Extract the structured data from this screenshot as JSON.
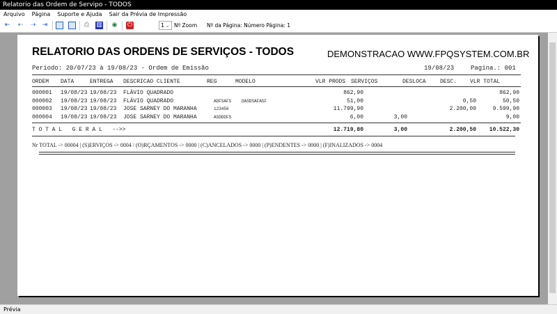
{
  "window": {
    "title": "Relatorio das Ordem de Servipo - TODOS"
  },
  "menu": [
    "Arquivo",
    "Página",
    "Suporte e Ajuda",
    "Sair da Prévia de Impressão"
  ],
  "toolbar": {
    "zoom_value": "1",
    "zoom_label": "Nº Zoom",
    "page_label": "Nº da Página: Número Página: 1"
  },
  "report": {
    "title": "RELATORIO DAS ORDENS DE SERVIÇOS - TODOS",
    "demo": "DEMONSTRACAO WWW.FPQSYSTEM.COM.BR",
    "period": "Periodo: 20/07/23 à 19/08/23 - Ordem de Emissão",
    "date": "19/08/23",
    "page": "Pagina.: 001",
    "headers": [
      "ORDEM",
      "DATA",
      "ENTREGA",
      "DESCRICAO CLIENTE",
      "REG",
      "MODELO",
      "VLR PRODS",
      "SERVIÇOS",
      "DESLOCA",
      "DESC.",
      "VLR TOTAL"
    ],
    "rows": [
      {
        "ordem": "000001",
        "data": "19/08/23",
        "entrega": "19/08/23",
        "cliente": "FLÁVIO QUADRADO",
        "reg": "",
        "modelo": "",
        "prods": "862,90",
        "serv": "",
        "desloca": "",
        "desc": "",
        "total": "862,90"
      },
      {
        "ordem": "000002",
        "data": "19/08/23",
        "entrega": "19/08/23",
        "cliente": "FLÁVIO QUADRADO",
        "reg": "ADFSAFS",
        "modelo": "DASDSAFASF",
        "prods": "51,00",
        "serv": "",
        "desloca": "",
        "desc": "0,50",
        "total": "50,50"
      },
      {
        "ordem": "000003",
        "data": "19/08/23",
        "entrega": "19/08/23",
        "cliente": "JOSE SARNEY DO MARANHA",
        "reg": "123456",
        "modelo": "",
        "prods": "11.799,90",
        "serv": "",
        "desloca": "",
        "desc": "2.200,00",
        "total": "9.599,90"
      },
      {
        "ordem": "000004",
        "data": "19/08/23",
        "entrega": "19/08/23",
        "cliente": "JOSE SARNEY DO MARANHA",
        "reg": "ASDDDFS",
        "modelo": "",
        "prods": "6,00",
        "serv": "3,00",
        "desloca": "",
        "desc": "",
        "total": "9,00"
      }
    ],
    "total_label": "T O T A L   G E R A L   -->>",
    "totals": {
      "prods": "12.719,80",
      "serv": "3,00",
      "desc": "2.200,50",
      "total": "10.522,30"
    },
    "summary": "Nr TOTAL -> 00004 | (S)ERVIÇOS -> 0004 / (O)RÇAMENTOS -> 0000 | (C)ANCELADOS -> 0000 | (P)ENDENTES -> 0000 | (F)INALIZADOS -> 0004"
  },
  "status": "Prévia"
}
